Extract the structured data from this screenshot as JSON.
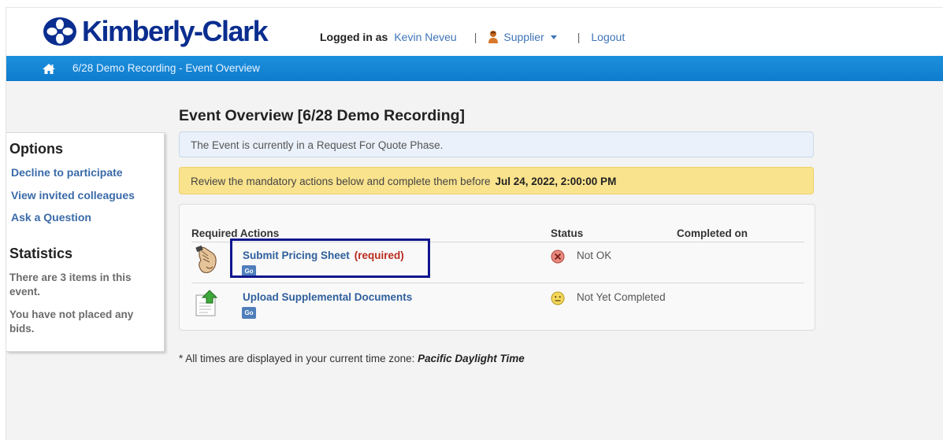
{
  "header": {
    "logo_text": "Kimberly-Clark",
    "logged_in_label": "Logged in as",
    "user_name": "Kevin Neveu",
    "separator": "|",
    "role": "Supplier",
    "logout": "Logout"
  },
  "breadcrumb": {
    "text": "6/28 Demo Recording - Event Overview"
  },
  "sidebar": {
    "options_heading": "Options",
    "links": [
      "Decline to participate",
      "View invited colleagues",
      "Ask a Question"
    ],
    "statistics_heading": "Statistics",
    "stats": [
      "There are 3 items in this event.",
      "You have not placed any bids."
    ]
  },
  "main": {
    "title": "Event Overview [6/28 Demo Recording]",
    "phase_message": "The Event is currently in a Request For Quote Phase.",
    "deadline_message": "Review the mandatory actions below and complete them before",
    "deadline_date": "Jul 24, 2022, 2:00:00 PM",
    "table": {
      "col_actions": "Required Actions",
      "col_status": "Status",
      "col_completed": "Completed on",
      "rows": [
        {
          "label": "Submit Pricing Sheet",
          "required": "(required)",
          "go": "Go",
          "status": "Not OK",
          "completed_on": ""
        },
        {
          "label": "Upload Supplemental Documents",
          "required": "",
          "go": "Go",
          "status": "Not Yet Completed",
          "completed_on": ""
        }
      ]
    },
    "footnote_prefix": "* All times are displayed in your current time zone:",
    "footnote_tz": "Pacific Daylight Time"
  },
  "colors": {
    "brand": "#0a2d8f",
    "nav_bar": "#1485d4",
    "link": "#2f5f9c",
    "required": "#b82a1e",
    "warning_bg": "#fae38d",
    "info_bg": "#eaf1fa",
    "highlight": "#10168e"
  },
  "icons": [
    "kc-logo-icon",
    "person-icon",
    "chevron-down-icon",
    "home-icon",
    "hand-icon",
    "upload-document-icon",
    "not-ok-status-icon",
    "pending-status-icon"
  ]
}
